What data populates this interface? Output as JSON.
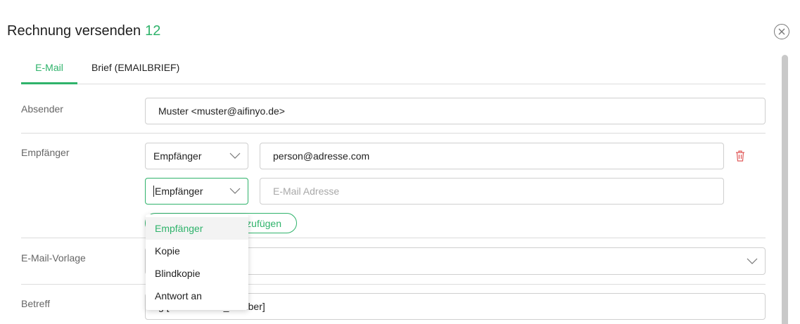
{
  "dialog": {
    "title": "Rechnung versenden",
    "count": "12"
  },
  "tabs": [
    {
      "label": "E-Mail",
      "active": true
    },
    {
      "label": "Brief (EMAILBRIEF)",
      "active": false
    }
  ],
  "labels": {
    "sender": "Absender",
    "recipient": "Empfänger",
    "template": "E-Mail-Vorlage",
    "subject": "Betreff"
  },
  "sender": {
    "value": "Muster <muster@aifinyo.de>"
  },
  "recipients": [
    {
      "type": "Empfänger",
      "email": "person@adresse.com",
      "email_placeholder": ""
    },
    {
      "type": "Empfänger",
      "email": "",
      "email_placeholder": "E-Mail Adresse"
    }
  ],
  "add_button": {
    "label_visible": "zufügen"
  },
  "type_options": [
    "Empfänger",
    "Kopie",
    "Blindkopie",
    "Antwort an"
  ],
  "subject": {
    "value_visible": "g [   oice.invoice_number]"
  },
  "colors": {
    "accent": "#2fb36b",
    "delete": "#e05a5a",
    "border": "#cfcfcf"
  },
  "icons": {
    "close": "close-circle-icon",
    "delete": "trash-icon",
    "chevron": "chevron-down-icon"
  }
}
